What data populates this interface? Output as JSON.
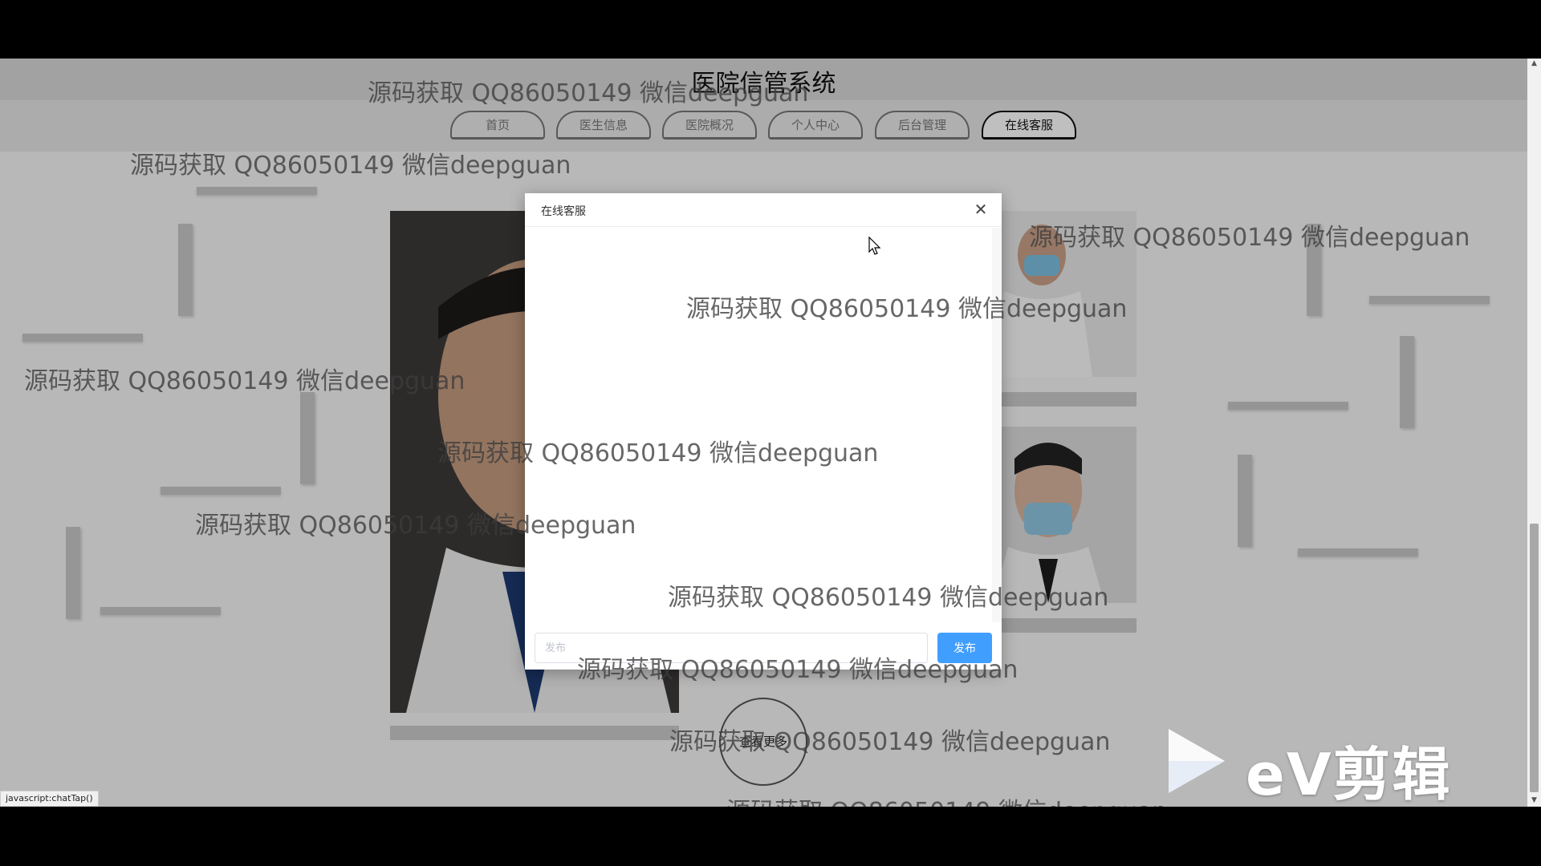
{
  "site": {
    "title": "医院信管系统"
  },
  "nav": {
    "items": [
      {
        "label": "首页",
        "active": false
      },
      {
        "label": "医生信息",
        "active": false
      },
      {
        "label": "医院概况",
        "active": false
      },
      {
        "label": "个人中心",
        "active": false
      },
      {
        "label": "后台管理",
        "active": false
      },
      {
        "label": "在线客服",
        "active": true
      }
    ]
  },
  "more_button": {
    "label": "查看更多"
  },
  "dialog": {
    "title": "在线客服",
    "close_icon": "close-icon",
    "input_placeholder": "发布",
    "input_value": "",
    "send_label": "发布",
    "send_color": "#409eff"
  },
  "status_bar": {
    "link": "javascript:chatTap()"
  },
  "watermark": {
    "text": "源码获取 QQ86050149 微信deepguan"
  },
  "video_logo": {
    "text": "eV剪辑",
    "icon": "play-icon"
  }
}
